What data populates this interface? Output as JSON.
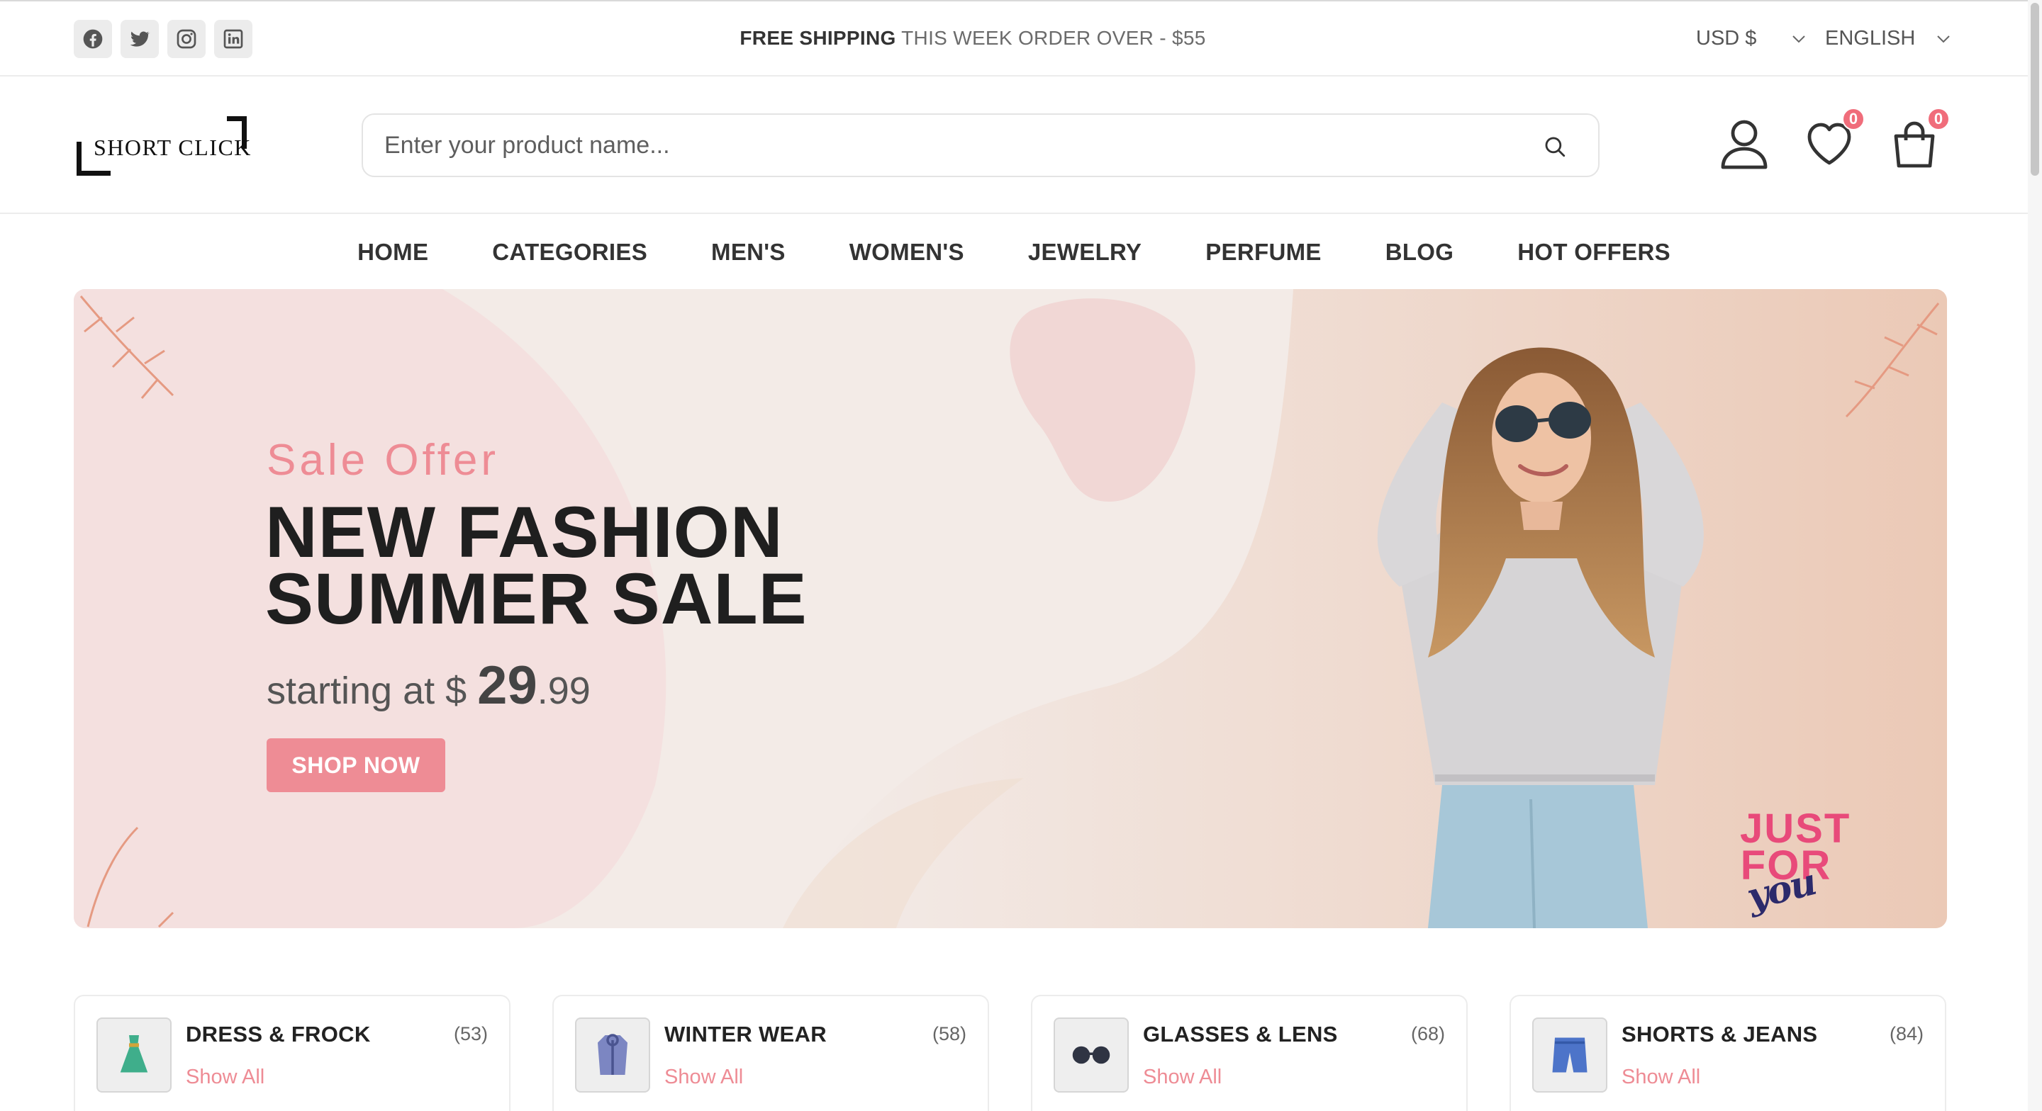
{
  "topbar": {
    "socials": [
      {
        "name": "facebook-icon"
      },
      {
        "name": "twitter-icon"
      },
      {
        "name": "instagram-icon"
      },
      {
        "name": "linkedin-icon"
      }
    ],
    "announcement_bold": "FREE SHIPPING",
    "announcement_rest": " THIS WEEK ORDER OVER - $55",
    "currency": "USD $",
    "language": "ENGLISH"
  },
  "header": {
    "logo_text": "SHORT CLICK",
    "search_placeholder": "Enter your product name...",
    "wishlist_count": "0",
    "cart_count": "0"
  },
  "nav": {
    "items": [
      "HOME",
      "CATEGORIES",
      "MEN'S",
      "WOMEN'S",
      "JEWELRY",
      "PERFUME",
      "BLOG",
      "HOT OFFERS"
    ]
  },
  "hero": {
    "kicker": "Sale Offer",
    "title_line1": "NEW FASHION",
    "title_line2": "SUMMER SALE",
    "price_prefix": "starting at $ ",
    "price_whole": "29",
    "price_cents": ".99",
    "cta": "SHOP NOW",
    "badge_line1": "JUST",
    "badge_line2": "FOR",
    "badge_line3": "you"
  },
  "categories": [
    {
      "name": "DRESS & FROCK",
      "count": "(53)",
      "link": "Show All",
      "icon": "dress-icon"
    },
    {
      "name": "WINTER WEAR",
      "count": "(58)",
      "link": "Show All",
      "icon": "coat-icon"
    },
    {
      "name": "GLASSES & LENS",
      "count": "(68)",
      "link": "Show All",
      "icon": "glasses-icon"
    },
    {
      "name": "SHORTS & JEANS",
      "count": "(84)",
      "link": "Show All",
      "icon": "shorts-icon"
    }
  ],
  "colors": {
    "accent": "#ee8c95",
    "badge": "#f06d7b",
    "hero_bg": "#f3ebe7",
    "text_dark": "#1f1f1f"
  }
}
